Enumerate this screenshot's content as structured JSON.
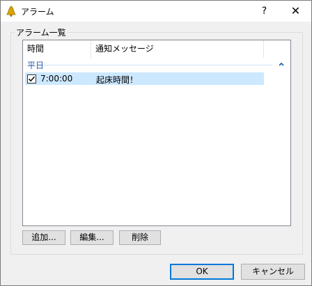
{
  "window": {
    "title": "アラーム",
    "help": "?",
    "close": "✕"
  },
  "group": {
    "label": "アラーム一覧"
  },
  "list": {
    "columns": [
      "時間",
      "通知メッセージ"
    ],
    "group_name": "平日",
    "rows": [
      {
        "checked": true,
        "time": "7:00:00",
        "message": "起床時間！"
      }
    ]
  },
  "buttons": {
    "add": "追加...",
    "edit": "編集...",
    "delete": "削除"
  },
  "footer": {
    "ok": "OK",
    "cancel": "キャンセル"
  },
  "icons": {
    "title": "bell-icon",
    "group_toggle": "chevron-up-icon",
    "check": "checkmark-icon"
  },
  "colors": {
    "selection": "#cce8ff",
    "group_text": "#1e5aa8",
    "accent": "#0078d7"
  }
}
